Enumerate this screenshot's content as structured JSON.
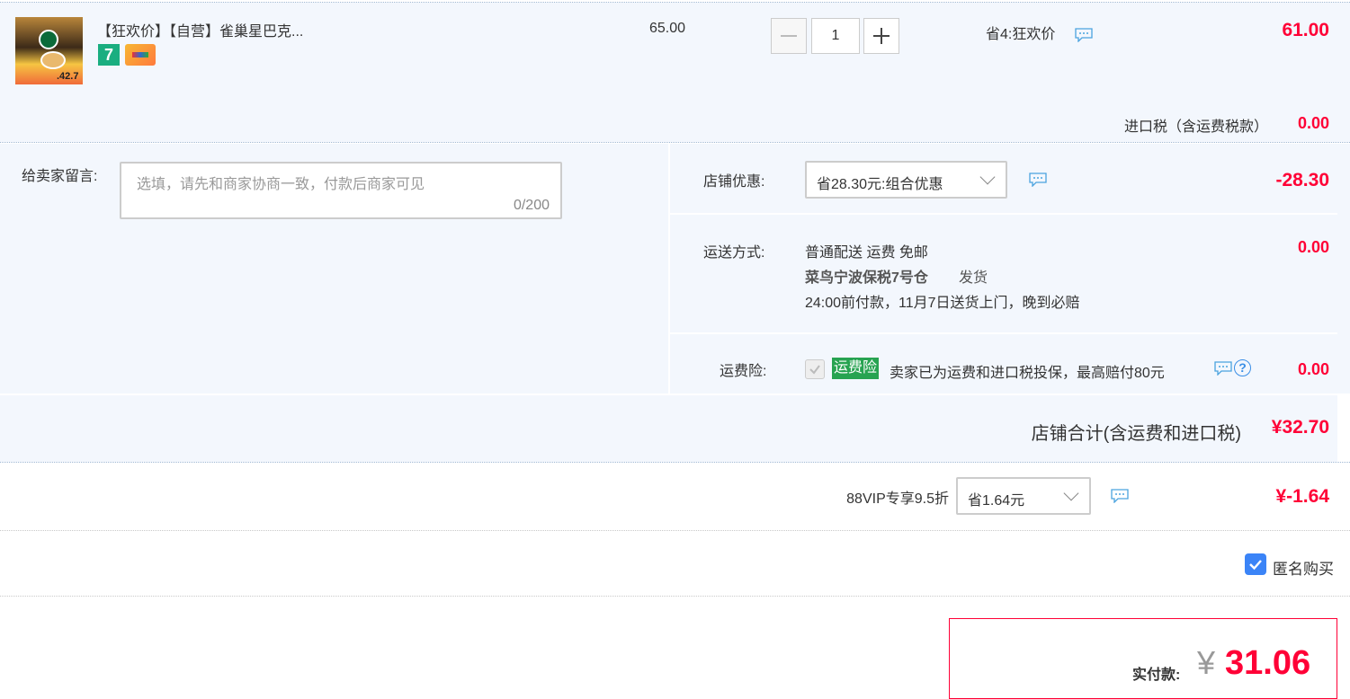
{
  "item": {
    "title": "【狂欢价】【自营】雀巢星巴克...",
    "thumb_price_text": ".42.7",
    "badge_number": "7",
    "unit_price": "65.00",
    "quantity": "1",
    "promo": "省4:狂欢价",
    "subtotal": "61.00",
    "import_tax_label": "进口税（含运费税款）",
    "import_tax_value": "0.00"
  },
  "message": {
    "label": "给卖家留言:",
    "placeholder": "选填，请先和商家协商一致，付款后商家可见",
    "counter": "0/200"
  },
  "shop_discount": {
    "label": "店铺优惠:",
    "selected": "省28.30元:组合优惠",
    "value": "-28.30"
  },
  "shipping": {
    "label": "运送方式:",
    "method": "普通配送 运费 免邮",
    "warehouse": "菜鸟宁波保税7号仓",
    "dispatch": "发货",
    "eta": "24:00前付款，11月7日送货上门，晚到必赔",
    "value": "0.00"
  },
  "insurance": {
    "label": "运费险:",
    "tag": "运费险",
    "desc": "卖家已为运费和进口税投保，最高赔付80元",
    "help": "?",
    "value": "0.00"
  },
  "shop_total": {
    "label": "店铺合计(含运费和进口税)",
    "value": "¥32.70"
  },
  "vip": {
    "label": "88VIP专享9.5折",
    "selected": "省1.64元",
    "value": "¥-1.64"
  },
  "anonymous": {
    "label": "匿名购买",
    "checked": true
  },
  "payment": {
    "label": "实付款:",
    "currency": "¥",
    "amount": "31.06"
  },
  "colors": {
    "accent_red": "#ff0036",
    "panel_bg": "#f3f7fd",
    "checkbox_blue": "#3b84f7",
    "tag_green": "#27a351"
  }
}
